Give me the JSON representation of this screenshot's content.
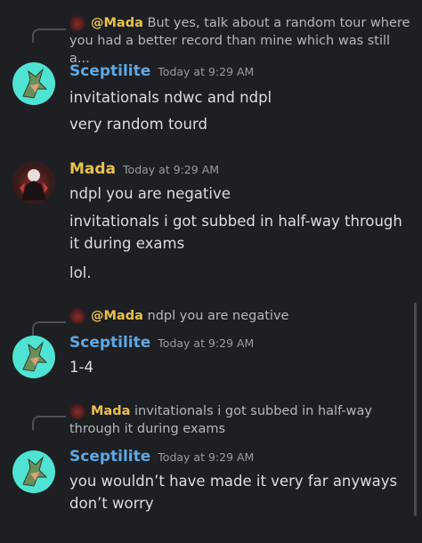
{
  "groups": [
    {
      "reply": {
        "name": "@Mada",
        "text": "But yes, talk about a random tour where you had a better record than mine which was still a..."
      },
      "author": "Sceptilite",
      "time": "Today at 9:29 AM",
      "messages": [
        "invitationals ndwc and ndpl",
        "very random tourd"
      ]
    },
    {
      "author": "Mada",
      "time": "Today at 9:29 AM",
      "messages": [
        "ndpl you are negative",
        "invitationals i got subbed in half-way through it during exams",
        "lol."
      ]
    },
    {
      "reply": {
        "name": "@Mada",
        "text": "ndpl you are negative"
      },
      "author": "Sceptilite",
      "time": "Today at 9:29 AM",
      "messages": [
        "1-4"
      ]
    },
    {
      "reply": {
        "name": "Mada",
        "text": "invitationals i got subbed in half-way through it during exams"
      },
      "author": "Sceptilite",
      "time": "Today at 9:29 AM",
      "messages": [
        "you wouldn’t have made it very far anyways don’t worry"
      ]
    }
  ],
  "colors": {
    "background": "#1e1f22",
    "sceptilite_name": "#5ea8e8",
    "mada_name": "#e8c14d",
    "sceptilite_avatar": "#4fe3d3"
  }
}
